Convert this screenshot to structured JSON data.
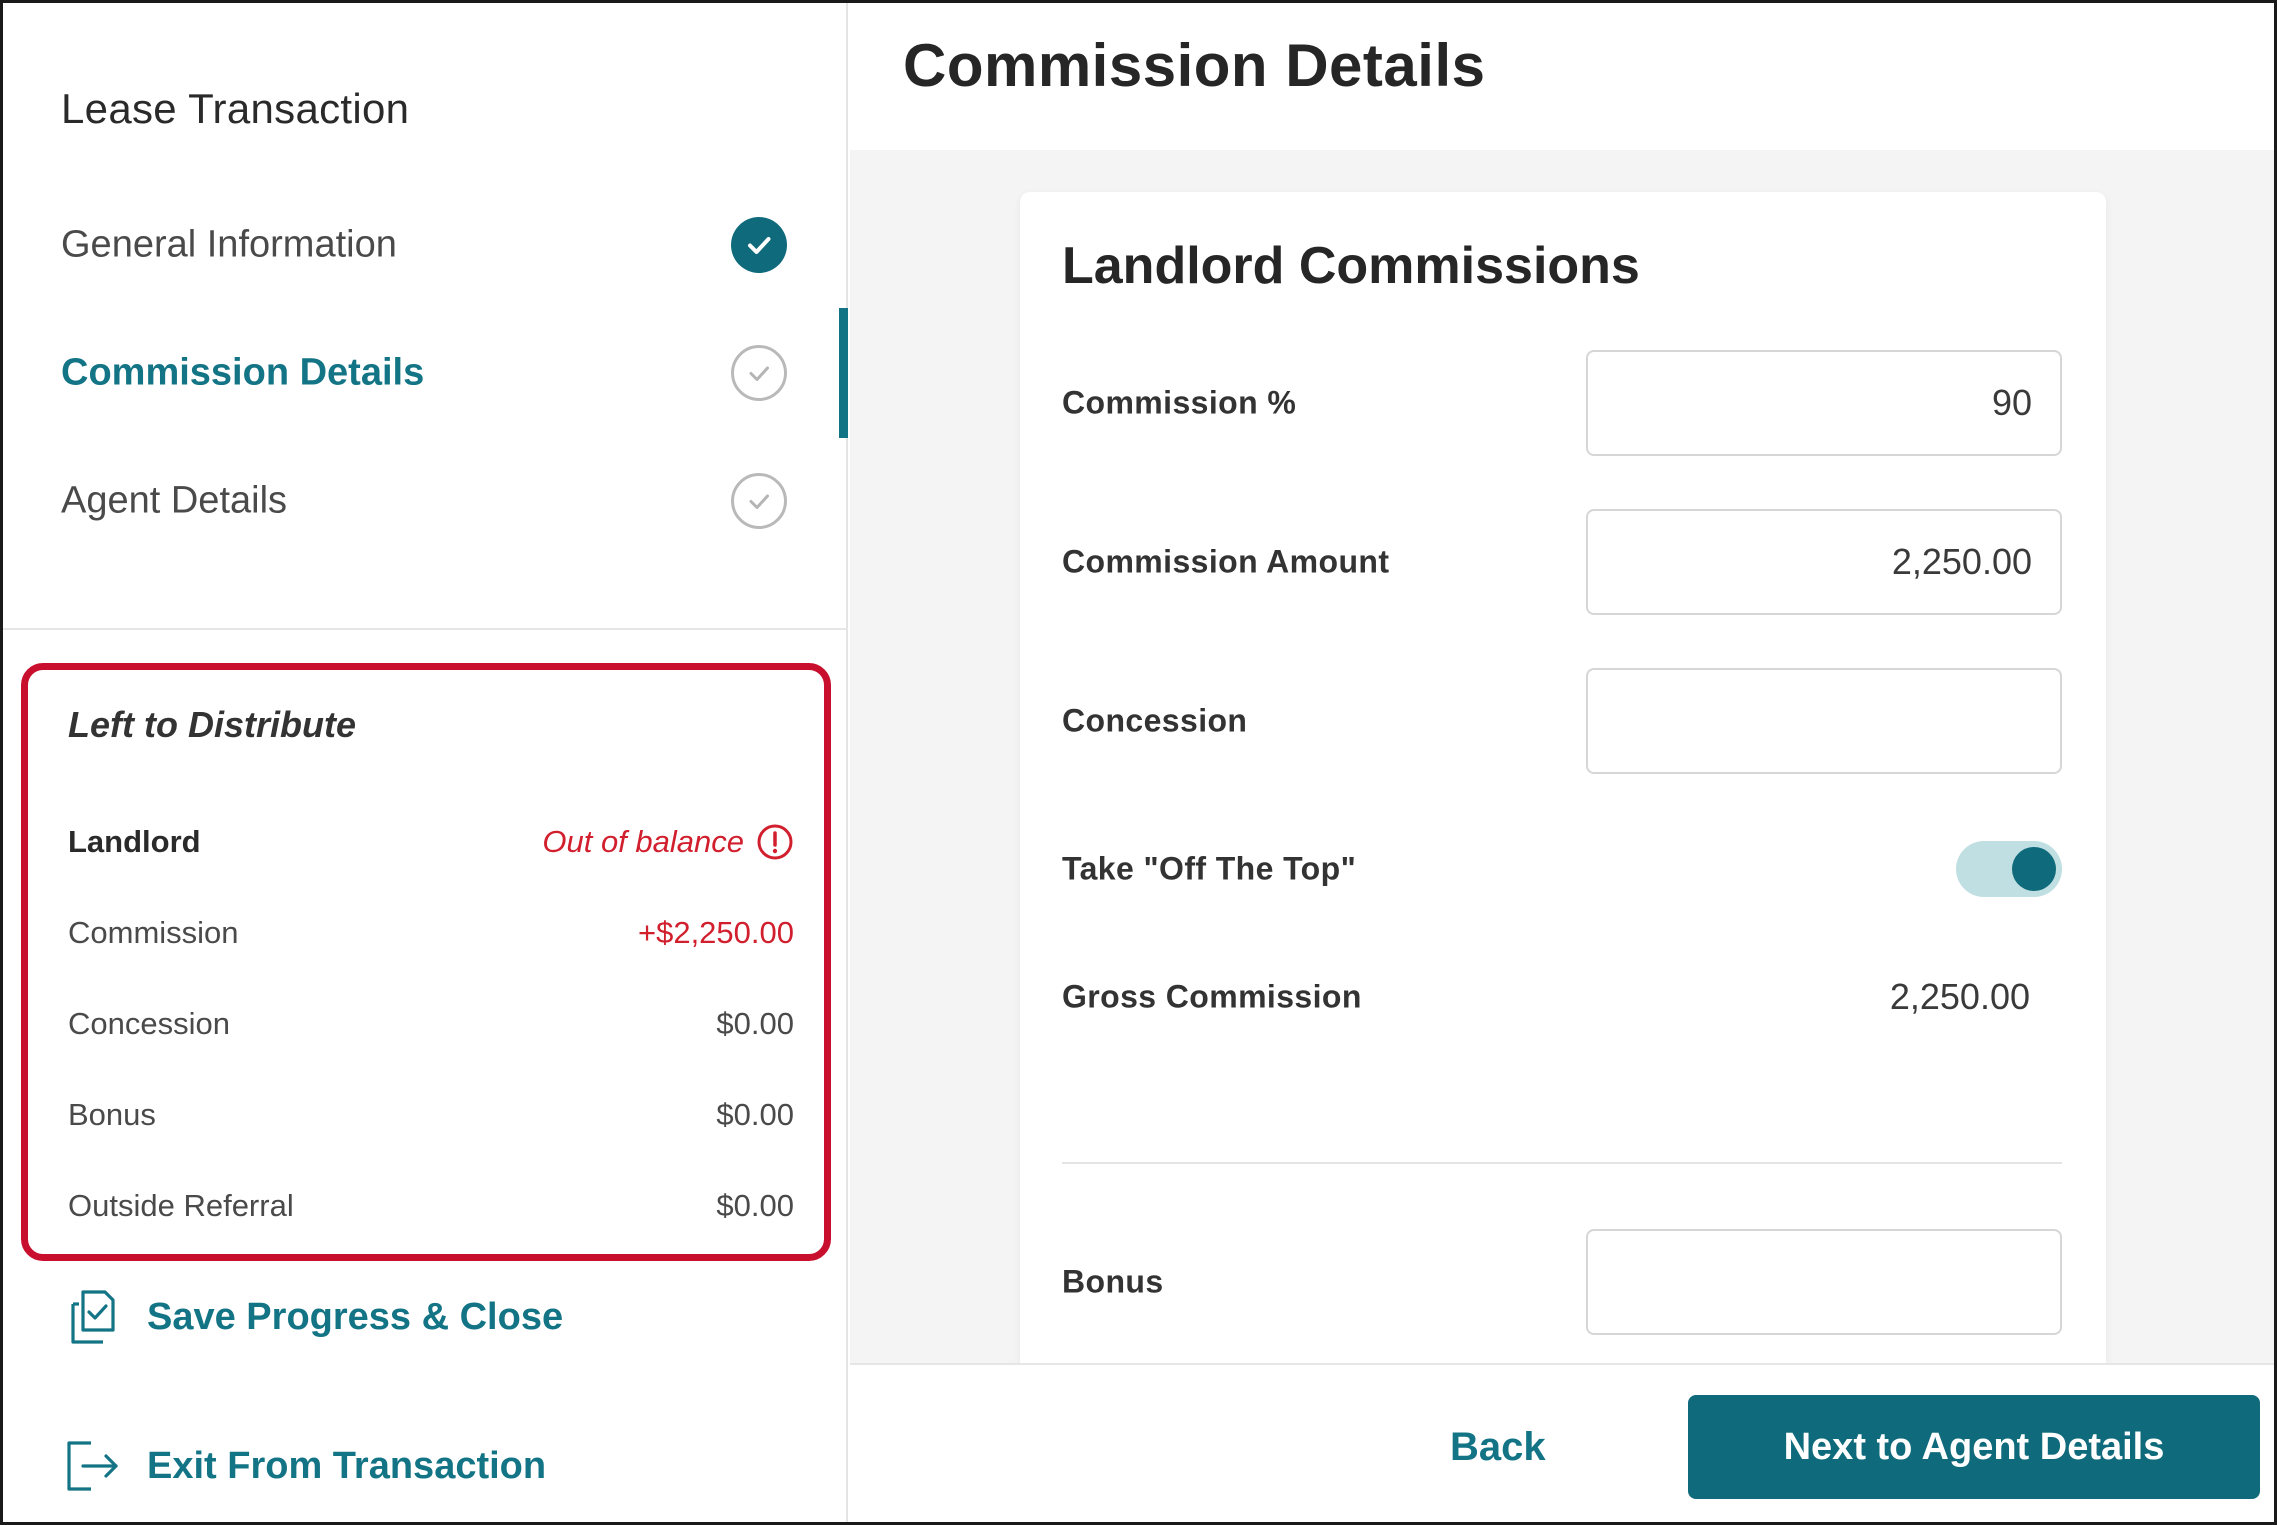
{
  "sidebar": {
    "title": "Lease Transaction",
    "steps": [
      {
        "label": "General Information",
        "status": "complete",
        "icon": "check-filled-icon"
      },
      {
        "label": "Commission Details",
        "status": "active",
        "icon": "check-outline-icon"
      },
      {
        "label": "Agent Details",
        "status": "pending",
        "icon": "check-outline-icon"
      }
    ],
    "distribute": {
      "title": "Left to Distribute",
      "landlord_label": "Landlord",
      "status_text": "Out of balance",
      "rows": [
        {
          "label": "Commission",
          "value": "+$2,250.00"
        },
        {
          "label": "Concession",
          "value": "$0.00"
        },
        {
          "label": "Bonus",
          "value": "$0.00"
        },
        {
          "label": "Outside Referral",
          "value": "$0.00"
        }
      ]
    },
    "save_label": "Save Progress & Close",
    "exit_label": "Exit From Transaction"
  },
  "page": {
    "title": "Commission Details"
  },
  "card": {
    "title": "Landlord Commissions",
    "commission_pct": {
      "label": "Commission %",
      "value": "90",
      "placeholder": ""
    },
    "commission_amount": {
      "label": "Commission Amount",
      "value": "2,250.00",
      "placeholder": ""
    },
    "concession": {
      "label": "Concession",
      "value": "",
      "placeholder": ""
    },
    "off_the_top": {
      "label": "Take \"Off The Top\"",
      "enabled": true
    },
    "gross_commission": {
      "label": "Gross Commission",
      "value": "2,250.00"
    },
    "bonus": {
      "label": "Bonus",
      "value": "",
      "placeholder": ""
    }
  },
  "footer": {
    "back_label": "Back",
    "next_label": "Next to Agent Details"
  },
  "colors": {
    "accent": "#137485",
    "accent_dark": "#0f6a7b",
    "error": "#d11f2e",
    "highlight_border": "#c8102e"
  }
}
